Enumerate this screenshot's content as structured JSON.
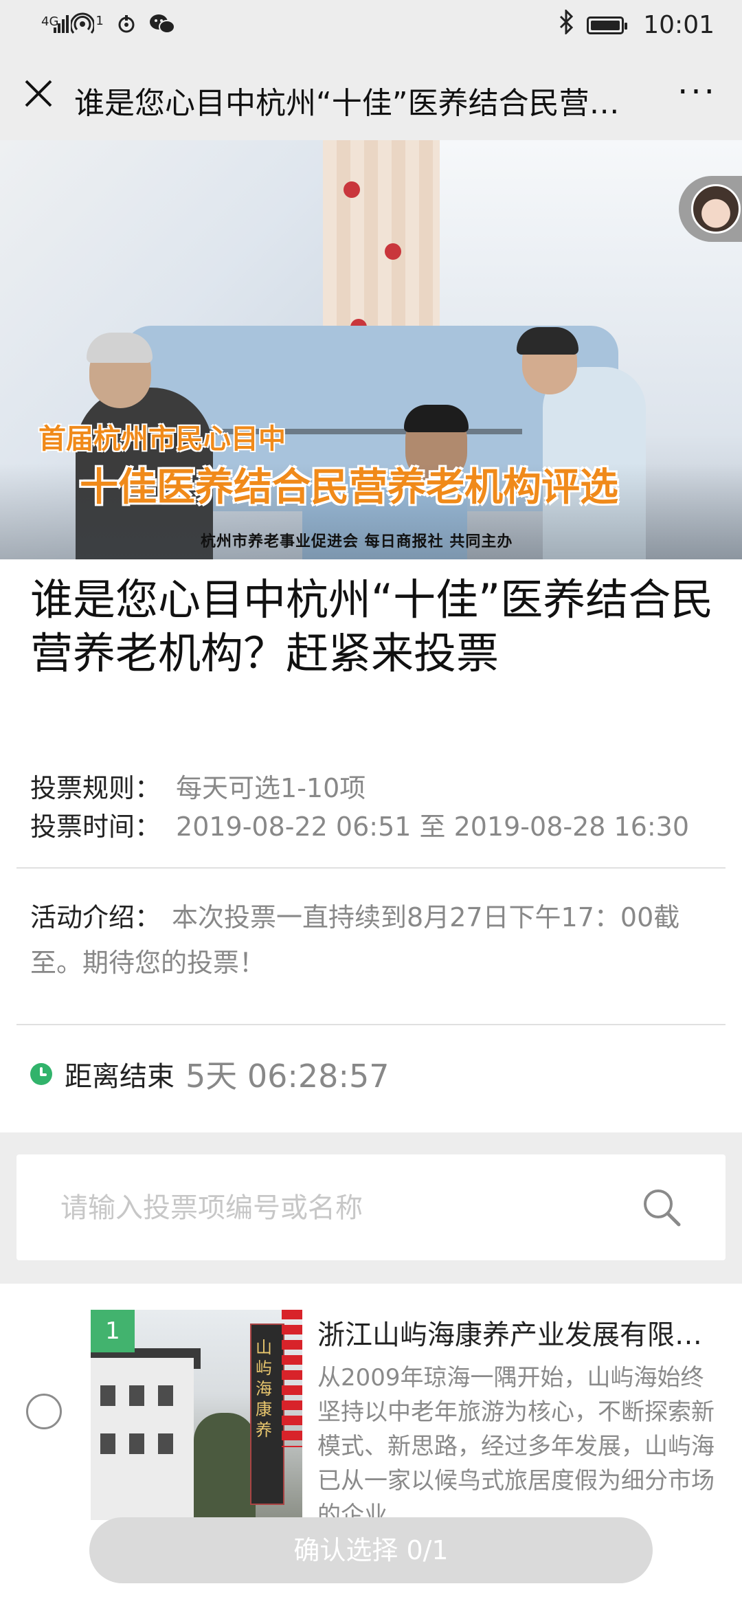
{
  "status_bar": {
    "network": "4G",
    "sim_index": "1",
    "time": "10:01"
  },
  "nav": {
    "title": "谁是您心目中杭州“十佳”医养结合民营养老机构？赶紧来投票",
    "more": "···"
  },
  "hero": {
    "line1": "首届杭州市民心目中",
    "line2": "十佳医养结合民营养老机构评选",
    "caption": "杭州市养老事业促进会   每日商报社   共同主办"
  },
  "article": {
    "title": "谁是您心目中杭州“十佳”医养结合民营养老机构？赶紧来投票",
    "rules_label": "投票规则：",
    "rules_value": "每天可选1-10项",
    "time_label": "投票时间：",
    "time_value": "2019-08-22 06:51 至 2019-08-28 16:30",
    "intro_label": "活动介绍：",
    "intro_value": "本次投票一直持续到8月27日下午17：00截至。期待您的投票！",
    "countdown_label": "距离结束",
    "countdown_value": "5天 06:28:57"
  },
  "search": {
    "placeholder": "请输入投票项编号或名称"
  },
  "items": [
    {
      "number": "1",
      "title": "浙江山屿海康养产业发展有限公司",
      "description": "从2009年琼海一隅开始，山屿海始终坚持以中老年旅游为核心，不断探索新模式、新思路，经过多年发展，山屿海已从一家以候鸟式旅居度假为细分市场的企业",
      "thumb_sign": "山屿海康养"
    }
  ],
  "confirm": {
    "label": "确认选择 0/1"
  },
  "colors": {
    "accent_green": "#42b36e",
    "hero_text_orange": "#f08a1a",
    "button_disabled": "#dadada"
  }
}
